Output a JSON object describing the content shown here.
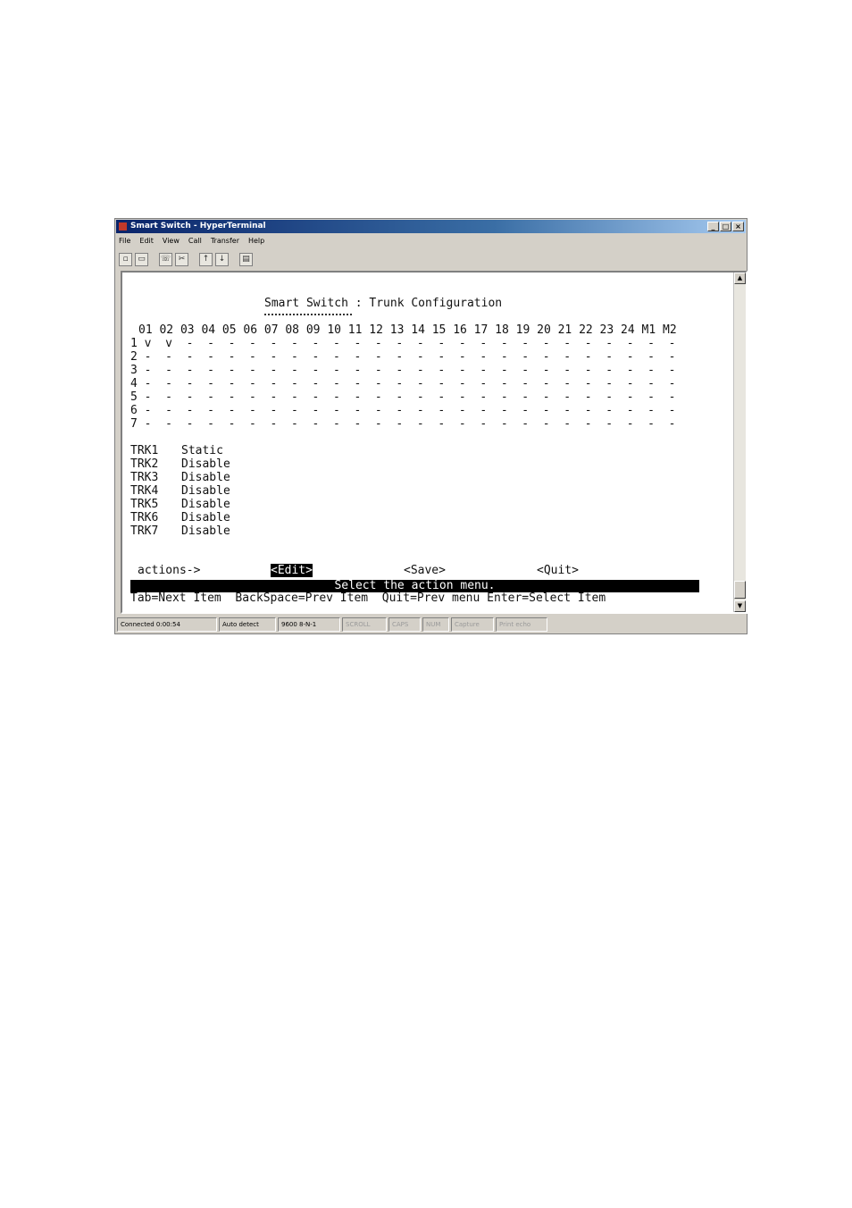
{
  "window": {
    "title": "Smart Switch - HyperTerminal",
    "buttons": [
      "_",
      "□",
      "×"
    ]
  },
  "menu": [
    "File",
    "Edit",
    "View",
    "Call",
    "Transfer",
    "Help"
  ],
  "terminal": {
    "title": "Smart Switch : Trunk Configuration",
    "port_header": "01 02 03 04 05 06 07 08 09 10 11 12 13 14 15 16 17 18 19 20 21 22 23 24 M1 M2",
    "rows": [
      "1 v  v  -  -  -  -  -  -  -  -  -  -  -  -  -  -  -  -  -  -  -  -  -  -  -  -",
      "2 -  -  -  -  -  -  -  -  -  -  -  -  -  -  -  -  -  -  -  -  -  -  -  -  -  -",
      "3 -  -  -  -  -  -  -  -  -  -  -  -  -  -  -  -  -  -  -  -  -  -  -  -  -  -",
      "4 -  -  -  -  -  -  -  -  -  -  -  -  -  -  -  -  -  -  -  -  -  -  -  -  -  -",
      "5 -  -  -  -  -  -  -  -  -  -  -  -  -  -  -  -  -  -  -  -  -  -  -  -  -  -",
      "6 -  -  -  -  -  -  -  -  -  -  -  -  -  -  -  -  -  -  -  -  -  -  -  -  -  -",
      "7 -  -  -  -  -  -  -  -  -  -  -  -  -  -  -  -  -  -  -  -  -  -  -  -  -  -"
    ],
    "trunks": [
      {
        "name": "TRK1",
        "mode": "Static"
      },
      {
        "name": "TRK2",
        "mode": "Disable"
      },
      {
        "name": "TRK3",
        "mode": "Disable"
      },
      {
        "name": "TRK4",
        "mode": "Disable"
      },
      {
        "name": "TRK5",
        "mode": "Disable"
      },
      {
        "name": "TRK6",
        "mode": "Disable"
      },
      {
        "name": "TRK7",
        "mode": "Disable"
      }
    ],
    "actions_label": "actions->",
    "action_edit": "<Edit>",
    "action_save": "<Save>",
    "action_quit": "<Quit>",
    "status_message": "Select the action menu.",
    "help_line": "Tab=Next Item  BackSpace=Prev Item  Quit=Prev menu Enter=Select Item"
  },
  "statusbar": {
    "connected": "Connected 0:00:54",
    "detect": "Auto detect",
    "settings": "9600 8-N-1",
    "scroll": "SCROLL",
    "caps": "CAPS",
    "num": "NUM",
    "capture": "Capture",
    "print_echo": "Print echo"
  }
}
